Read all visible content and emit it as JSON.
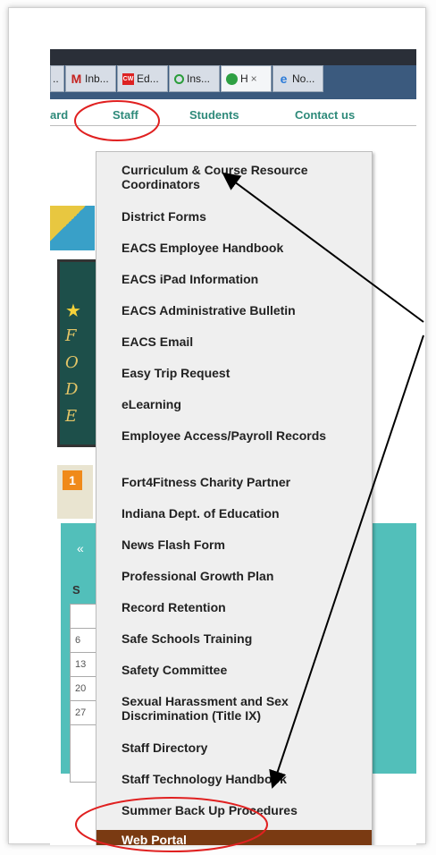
{
  "browser": {
    "tabs": [
      {
        "label": "..",
        "icon": "tab-overflow-icon"
      },
      {
        "label": "Inb...",
        "icon": "gmail-icon"
      },
      {
        "label": "Ed...",
        "icon": "cw-icon"
      },
      {
        "label": "Ins...",
        "icon": "circle-icon"
      },
      {
        "label": "H",
        "icon": "apple-icon",
        "active": true
      },
      {
        "label": "No...",
        "icon": "ie-icon"
      }
    ]
  },
  "nav": {
    "items": [
      "ard",
      "Staff",
      "Students",
      "Contact us"
    ]
  },
  "background": {
    "calendar_day": "1",
    "panel_arrows": "«",
    "panel_label": "S",
    "calendar_rows": [
      "",
      "6",
      "13",
      "20",
      "27"
    ],
    "banner_letters": [
      "F",
      "O",
      "D",
      "E"
    ]
  },
  "menu": {
    "items": [
      "Curriculum & Course Resource Coordinators",
      "District Forms",
      "EACS Employee Handbook",
      "EACS iPad Information",
      "EACS Administrative Bulletin",
      "EACS Email",
      "Easy Trip Request",
      "eLearning",
      "Employee Access/Payroll Records",
      "Fort4Fitness Charity Partner",
      "Indiana Dept. of Education",
      "News Flash Form",
      "Professional Growth Plan",
      "Record Retention",
      "Safe Schools Training",
      "Safety Committee",
      "Sexual Harassment and Sex Discrimination (Title IX)",
      "Staff Directory",
      "Staff Technology Handbook",
      "Summer Back Up Procedures",
      "Web Portal"
    ],
    "highlighted": "Web Portal"
  },
  "colors": {
    "nav_text": "#2e8a7a",
    "highlight": "#7a3a12",
    "annotation": "#e02020"
  }
}
